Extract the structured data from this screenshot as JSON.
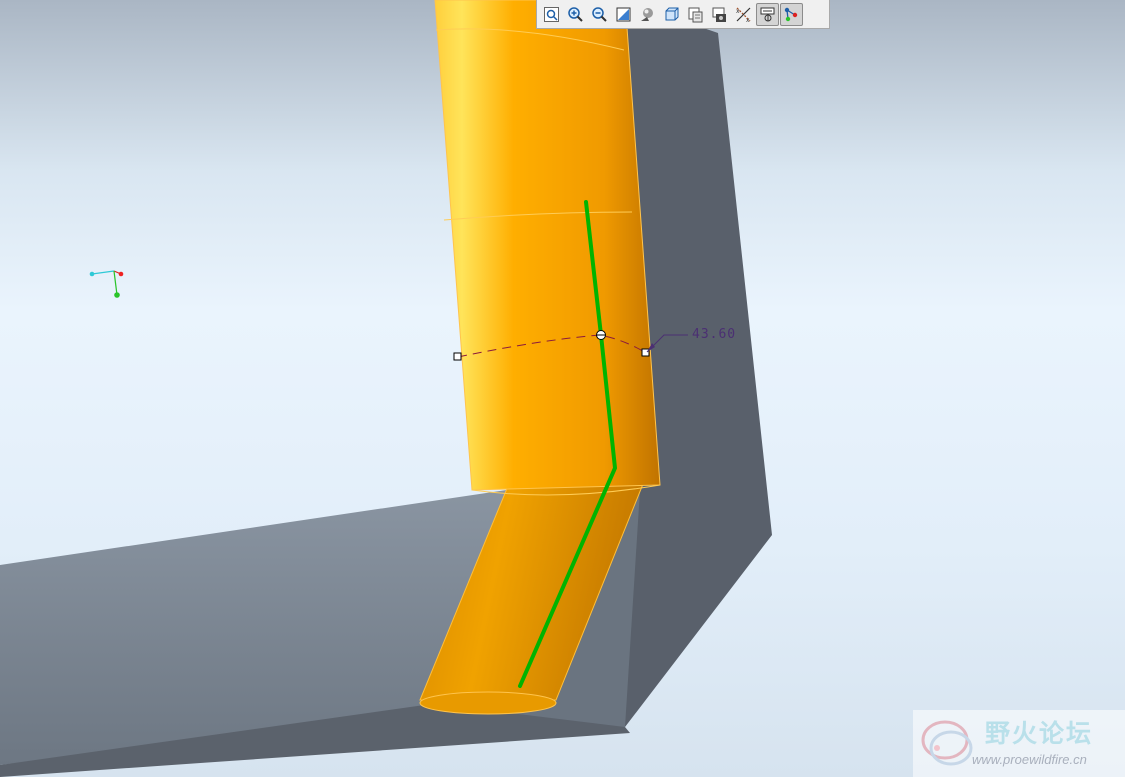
{
  "toolbar": {
    "buttons": [
      {
        "name": "refit-icon",
        "active": false
      },
      {
        "name": "zoom-in-icon",
        "active": false
      },
      {
        "name": "zoom-out-icon",
        "active": false
      },
      {
        "name": "repaint-icon",
        "active": false
      },
      {
        "name": "shading-icon",
        "active": false
      },
      {
        "name": "saved-views-icon",
        "active": false
      },
      {
        "name": "layers-icon",
        "active": false
      },
      {
        "name": "view-manager-icon",
        "active": false
      },
      {
        "name": "datum-display-icon",
        "active": false
      },
      {
        "name": "annotation-display-icon",
        "active": true
      },
      {
        "name": "spin-center-icon",
        "active": true
      }
    ]
  },
  "dimension": {
    "value": "43.60"
  },
  "watermark": {
    "title": "野火论坛",
    "url": "www.proewildfire.cn"
  },
  "colors": {
    "pipe_light": "#ffd84a",
    "pipe_mid": "#ffab00",
    "pipe_dark": "#c97a00",
    "trajectory": "#00b400",
    "frame_light": "#7f8a96",
    "frame_dark": "#5a626d",
    "dimension": "#4b2f73"
  }
}
